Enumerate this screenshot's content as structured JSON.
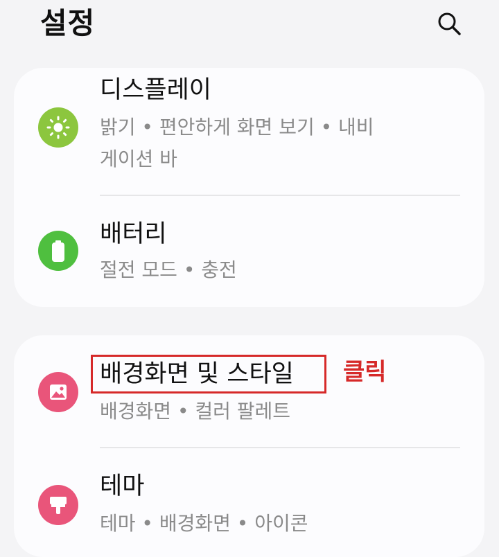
{
  "header": {
    "title": "설정",
    "search_icon": "search-icon"
  },
  "groups": [
    {
      "items": [
        {
          "title": "디스플레이",
          "subtitle": "밝기 • 편안하게 화면 보기 • 내비게이션 바",
          "icon": "brightness-icon",
          "icon_color": "#8cc63e"
        },
        {
          "title": "배터리",
          "subtitle": "절전 모드 • 충전",
          "icon": "battery-icon",
          "icon_color": "#4fbf3f"
        }
      ]
    },
    {
      "items": [
        {
          "title": "배경화면 및 스타일",
          "subtitle": "배경화면 • 컬러 팔레트",
          "icon": "wallpaper-icon",
          "icon_color": "#e9557a"
        },
        {
          "title": "테마",
          "subtitle": "테마 • 배경화면 • 아이콘",
          "icon": "paint-brush-icon",
          "icon_color": "#e9557a"
        }
      ]
    }
  ],
  "annotation": {
    "click_label": "클릭",
    "highlight_color": "#d62929"
  }
}
